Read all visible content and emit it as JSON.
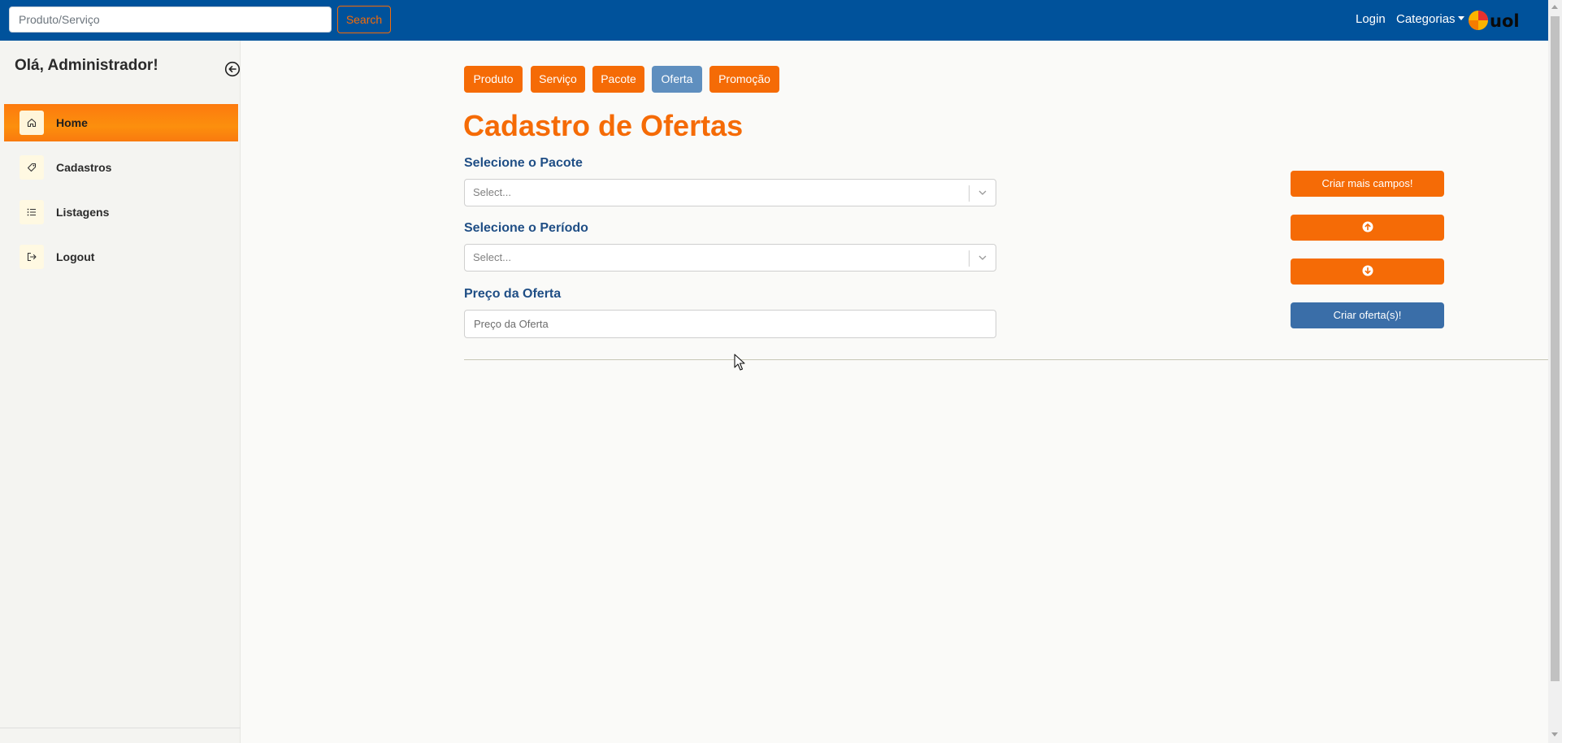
{
  "navbar": {
    "search_placeholder": "Produto/Serviço",
    "search_button": "Search",
    "login": "Login",
    "categorias": "Categorias",
    "logo_text": "uol"
  },
  "sidebar": {
    "greeting": "Olá, Administrador!",
    "items": [
      {
        "label": "Home",
        "icon": "home-icon",
        "active": true
      },
      {
        "label": "Cadastros",
        "icon": "tag-icon",
        "active": false
      },
      {
        "label": "Listagens",
        "icon": "list-icon",
        "active": false
      },
      {
        "label": "Logout",
        "icon": "logout-icon",
        "active": false
      }
    ]
  },
  "tabs": [
    {
      "label": "Produto",
      "active": false
    },
    {
      "label": "Serviço",
      "active": false
    },
    {
      "label": "Pacote",
      "active": false
    },
    {
      "label": "Oferta",
      "active": true
    },
    {
      "label": "Promoção",
      "active": false
    }
  ],
  "form": {
    "title": "Cadastro de Ofertas",
    "pacote_label": "Selecione o Pacote",
    "pacote_placeholder": "Select...",
    "periodo_label": "Selecione o Período",
    "periodo_placeholder": "Select...",
    "preco_label": "Preço da Oferta",
    "preco_placeholder": "Preço da Oferta"
  },
  "actions": {
    "criar_campos": "Criar mais campos!",
    "move_up_icon": "arrow-up-circle-icon",
    "move_down_icon": "arrow-down-circle-icon",
    "criar_ofertas": "Criar oferta(s)!"
  },
  "colors": {
    "navbar": "#00529b",
    "accent_orange": "#f56b06",
    "active_tab": "#5f8fbf",
    "submit_blue": "#3a6ea8",
    "label_blue": "#1f4e85"
  }
}
